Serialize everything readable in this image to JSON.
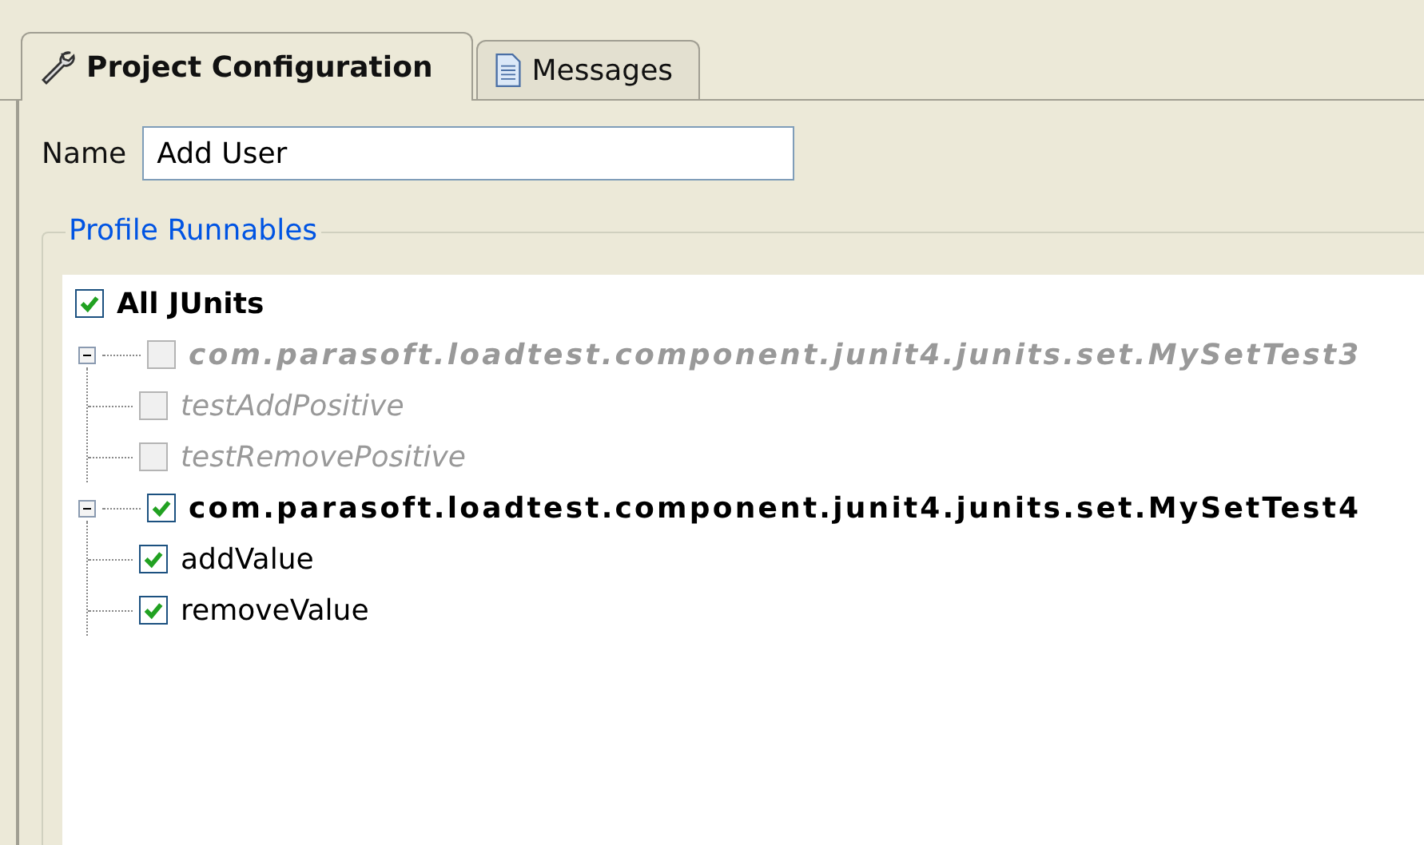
{
  "tabs": [
    {
      "label": "Project Configuration",
      "kind": "wrench",
      "selected": true
    },
    {
      "label": "Messages",
      "kind": "document",
      "selected": false
    }
  ],
  "name_field": {
    "label": "Name",
    "value": "Add User"
  },
  "group": {
    "title": "Profile Runnables"
  },
  "tree": {
    "label": "All JUnits",
    "checked": true,
    "children": [
      {
        "label": "com.parasoft.loadtest.component.junit4.junits.set.MySetTest3",
        "checked": false,
        "disabled": true,
        "expanded": true,
        "children": [
          {
            "label": "testAddPositive",
            "checked": false,
            "disabled": true
          },
          {
            "label": "testRemovePositive",
            "checked": false,
            "disabled": true
          }
        ]
      },
      {
        "label": "com.parasoft.loadtest.component.junit4.junits.set.MySetTest4",
        "checked": true,
        "disabled": false,
        "expanded": true,
        "children": [
          {
            "label": "addValue",
            "checked": true,
            "disabled": false
          },
          {
            "label": "removeValue",
            "checked": true,
            "disabled": false
          }
        ]
      }
    ]
  }
}
